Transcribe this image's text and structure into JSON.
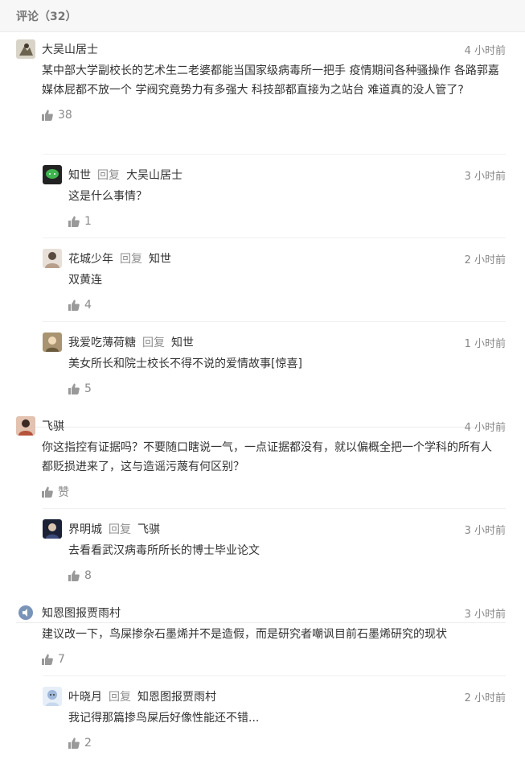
{
  "header": {
    "title": "评论（32）"
  },
  "comments": [
    {
      "author": "大吴山居士",
      "time": "4 小时前",
      "text": "某中部大学副校长的艺术生二老婆都能当国家级病毒所一把手 疫情期间各种骚操作 各路郭嘉媒体屁都不放一个 学阀究竟势力有多强大 科技部都直接为之站台 难道真的没人管了?",
      "likes": "38",
      "avatar_color": "#8a7f6a",
      "replies": [
        {
          "author": "知世",
          "reply_word": "回复",
          "target": "大吴山居士",
          "time": "3 小时前",
          "text": "这是什么事情？",
          "likes": "1",
          "avatar_color": "#3fb34f"
        },
        {
          "author": "花城少年",
          "reply_word": "回复",
          "target": "知世",
          "time": "2 小时前",
          "text": "双黄连",
          "likes": "4",
          "avatar_color": "#c9b8a8"
        },
        {
          "author": "我爱吃薄荷糖",
          "reply_word": "回复",
          "target": "知世",
          "time": "1 小时前",
          "text": "美女所长和院士校长不得不说的爱情故事[惊喜]",
          "likes": "5",
          "avatar_color": "#8c7a55"
        }
      ]
    },
    {
      "author": "飞骐",
      "time": "4 小时前",
      "text": "你这指控有证据吗？不要随口瞎说一气，一点证据都没有，就以偏概全把一个学科的所有人都贬损进来了，这与造谣污蔑有何区别？",
      "likes": "赞",
      "avatar_color": "#b5533a",
      "replies": [
        {
          "author": "界明城",
          "reply_word": "回复",
          "target": "飞骐",
          "time": "3 小时前",
          "text": "去看看武汉病毒所所长的博士毕业论文",
          "likes": "8",
          "avatar_color": "#2c3550"
        }
      ]
    },
    {
      "author": "知恩图报贾雨村",
      "time": "3 小时前",
      "text": "建议改一下，鸟屎掺杂石墨烯并不是造假，而是研究者嘲讽目前石墨烯研究的现状",
      "likes": "7",
      "avatar_color": "#7a93b8",
      "replies": [
        {
          "author": "叶晓月",
          "reply_word": "回复",
          "target": "知恩图报贾雨村",
          "time": "2 小时前",
          "text": "我记得那篇掺鸟屎后好像性能还不错...",
          "likes": "2",
          "avatar_color": "#9fb7d8"
        }
      ]
    }
  ]
}
